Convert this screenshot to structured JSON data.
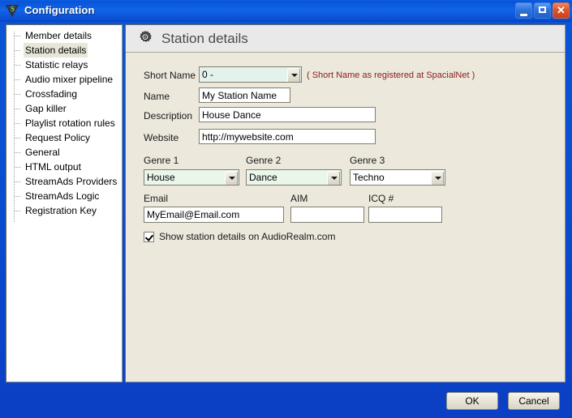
{
  "window": {
    "title": "Configuration",
    "app_icon": "shield-icon",
    "minimize_label": "Minimize",
    "maximize_label": "Maximize",
    "close_label": "Close"
  },
  "sidebar": {
    "items": [
      {
        "label": "Member details",
        "selected": false
      },
      {
        "label": "Station details",
        "selected": true
      },
      {
        "label": "Statistic relays",
        "selected": false
      },
      {
        "label": "Audio mixer pipeline",
        "selected": false
      },
      {
        "label": "Crossfading",
        "selected": false
      },
      {
        "label": "Gap killer",
        "selected": false
      },
      {
        "label": "Playlist rotation rules",
        "selected": false
      },
      {
        "label": "Request Policy",
        "selected": false
      },
      {
        "label": "General",
        "selected": false
      },
      {
        "label": "HTML output",
        "selected": false
      },
      {
        "label": "StreamAds Providers",
        "selected": false
      },
      {
        "label": "StreamAds Logic",
        "selected": false
      },
      {
        "label": "Registration Key",
        "selected": false
      }
    ]
  },
  "panel": {
    "icon": "gear-icon",
    "title": "Station details",
    "fields": {
      "short_name_label": "Short Name",
      "short_name_value": "0 -",
      "short_name_hint": "( Short Name as registered at SpacialNet )",
      "name_label": "Name",
      "name_value": "My Station Name",
      "description_label": "Description",
      "description_value": "House Dance",
      "website_label": "Website",
      "website_value": "http://mywebsite.com",
      "genre1_label": "Genre 1",
      "genre1_value": "House",
      "genre2_label": "Genre 2",
      "genre2_value": "Dance",
      "genre3_label": "Genre 3",
      "genre3_value": "Techno",
      "email_label": "Email",
      "email_value": "MyEmail@Email.com",
      "aim_label": "AIM",
      "aim_value": "",
      "icq_label": "ICQ #",
      "icq_value": "",
      "show_details_label": "Show station details on AudioRealm.com",
      "show_details_checked": true
    }
  },
  "footer": {
    "ok_label": "OK",
    "cancel_label": "Cancel"
  },
  "colors": {
    "titlebar_blue": "#0a53d8",
    "panel_bg": "#ece8dc",
    "hint_red": "#8c2020",
    "selected_bg": "#e8e6d8",
    "combo_tint": "#e4f2ee",
    "combo_tint2": "#eaf6ea"
  }
}
